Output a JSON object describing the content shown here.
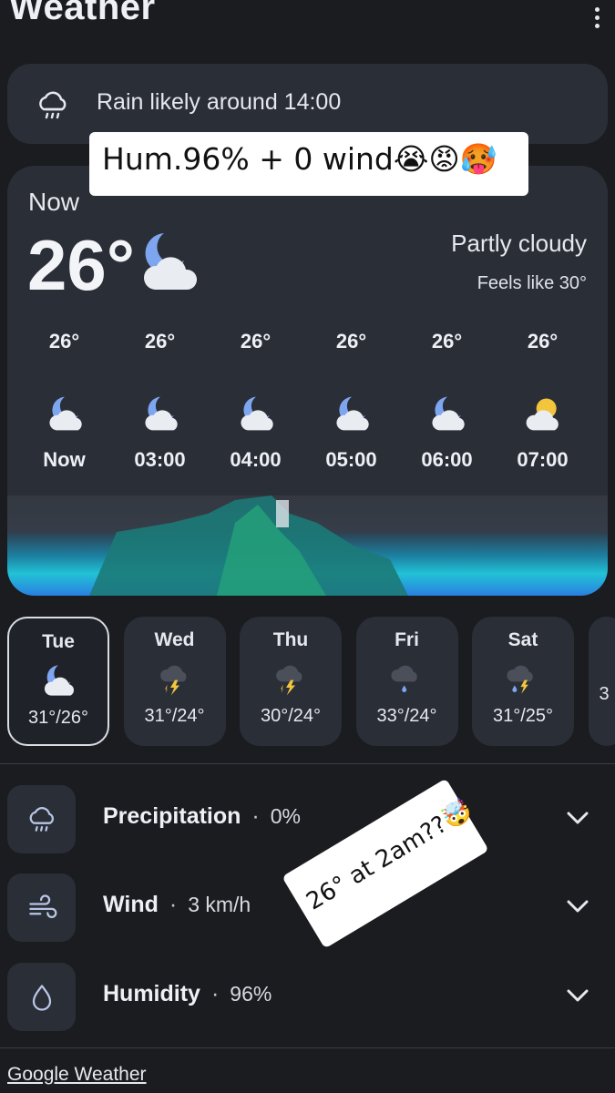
{
  "app": {
    "title": "Weather"
  },
  "alert": {
    "text": "Rain likely around 14:00",
    "icon": "rain-cloud-icon"
  },
  "sticker_top": {
    "text": "Hum.96% + 0 wind😭😡🥵"
  },
  "now": {
    "label": "Now",
    "temp": "26°",
    "condition": "Partly cloudy",
    "feels_like": "Feels like 30°",
    "icon": "moon-cloud-icon"
  },
  "hourly": [
    {
      "temp": "26°",
      "label": "Now",
      "icon": "moon-cloud-icon"
    },
    {
      "temp": "26°",
      "label": "03:00",
      "icon": "moon-cloud-icon"
    },
    {
      "temp": "26°",
      "label": "04:00",
      "icon": "moon-cloud-icon"
    },
    {
      "temp": "26°",
      "label": "05:00",
      "icon": "moon-cloud-icon"
    },
    {
      "temp": "26°",
      "label": "06:00",
      "icon": "moon-cloud-icon"
    },
    {
      "temp": "26°",
      "label": "07:00",
      "icon": "sun-cloud-icon"
    }
  ],
  "daily": [
    {
      "day": "Tue",
      "range": "31°/26°",
      "icon": "moon-cloud-icon",
      "selected": true
    },
    {
      "day": "Wed",
      "range": "31°/24°",
      "icon": "thunderstorm-icon"
    },
    {
      "day": "Thu",
      "range": "30°/24°",
      "icon": "thunderstorm-icon"
    },
    {
      "day": "Fri",
      "range": "33°/24°",
      "icon": "rain-cloud-icon"
    },
    {
      "day": "Sat",
      "range": "31°/25°",
      "icon": "thunder-rain-icon"
    },
    {
      "day": "",
      "range": "3",
      "icon": ""
    }
  ],
  "details": [
    {
      "name": "Precipitation",
      "value": "0%",
      "icon": "rain-cloud-icon"
    },
    {
      "name": "Wind",
      "value": "3 km/h",
      "icon": "wind-icon"
    },
    {
      "name": "Humidity",
      "value": "96%",
      "icon": "water-drop-icon"
    }
  ],
  "sticker_bottom": {
    "text": "26° at 2am??🤯"
  },
  "footer": {
    "link": "Google Weather"
  },
  "colors": {
    "background": "#1b1c20",
    "card": "#2a2e37",
    "text": "#e6e8ee",
    "moon": "#7ea6f0"
  }
}
